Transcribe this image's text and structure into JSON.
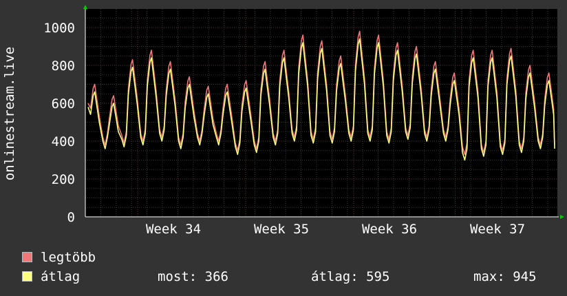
{
  "chart_data": {
    "type": "line",
    "ylabel": "onlinestream.live",
    "y_ticks": [
      "0",
      "200",
      "400",
      "600",
      "800",
      "1000"
    ],
    "x_ticks": [
      "Week 34",
      "Week 35",
      "Week 36",
      "Week 37"
    ],
    "ylim": [
      0,
      1000
    ],
    "grid": true,
    "colors": {
      "background": "#333333",
      "plot": "#000000",
      "grid": "#4a4a4a",
      "axis": "#ffffff",
      "arrow": "#00cc00"
    },
    "series": [
      {
        "name": "legtöbb",
        "color": "#f07878",
        "peaks": [
          700,
          640,
          830,
          880,
          820,
          740,
          690,
          700,
          720,
          820,
          880,
          960,
          930,
          850,
          980,
          960,
          920,
          900,
          820,
          760,
          880,
          880,
          890,
          800,
          760
        ],
        "troughs": [
          380,
          390,
          400,
          420,
          380,
          400,
          400,
          350,
          360,
          400,
          420,
          410,
          410,
          420,
          420,
          410,
          430,
          420,
          420,
          330,
          340,
          350,
          360,
          380
        ]
      },
      {
        "name": "átlag",
        "color": "#ffff80",
        "peaks": [
          660,
          600,
          790,
          840,
          780,
          700,
          650,
          660,
          680,
          780,
          840,
          920,
          890,
          810,
          940,
          920,
          880,
          860,
          780,
          720,
          840,
          840,
          850,
          760,
          720
        ],
        "troughs": [
          360,
          370,
          380,
          400,
          360,
          380,
          380,
          330,
          340,
          380,
          400,
          390,
          390,
          400,
          400,
          390,
          410,
          400,
          400,
          300,
          320,
          330,
          340,
          360
        ]
      }
    ]
  },
  "legend": {
    "max_label": "legtöbb",
    "avg_label": "átlag",
    "now_text": "most: 366",
    "avg_text": "átlag: 595",
    "max_text": "max: 945"
  }
}
